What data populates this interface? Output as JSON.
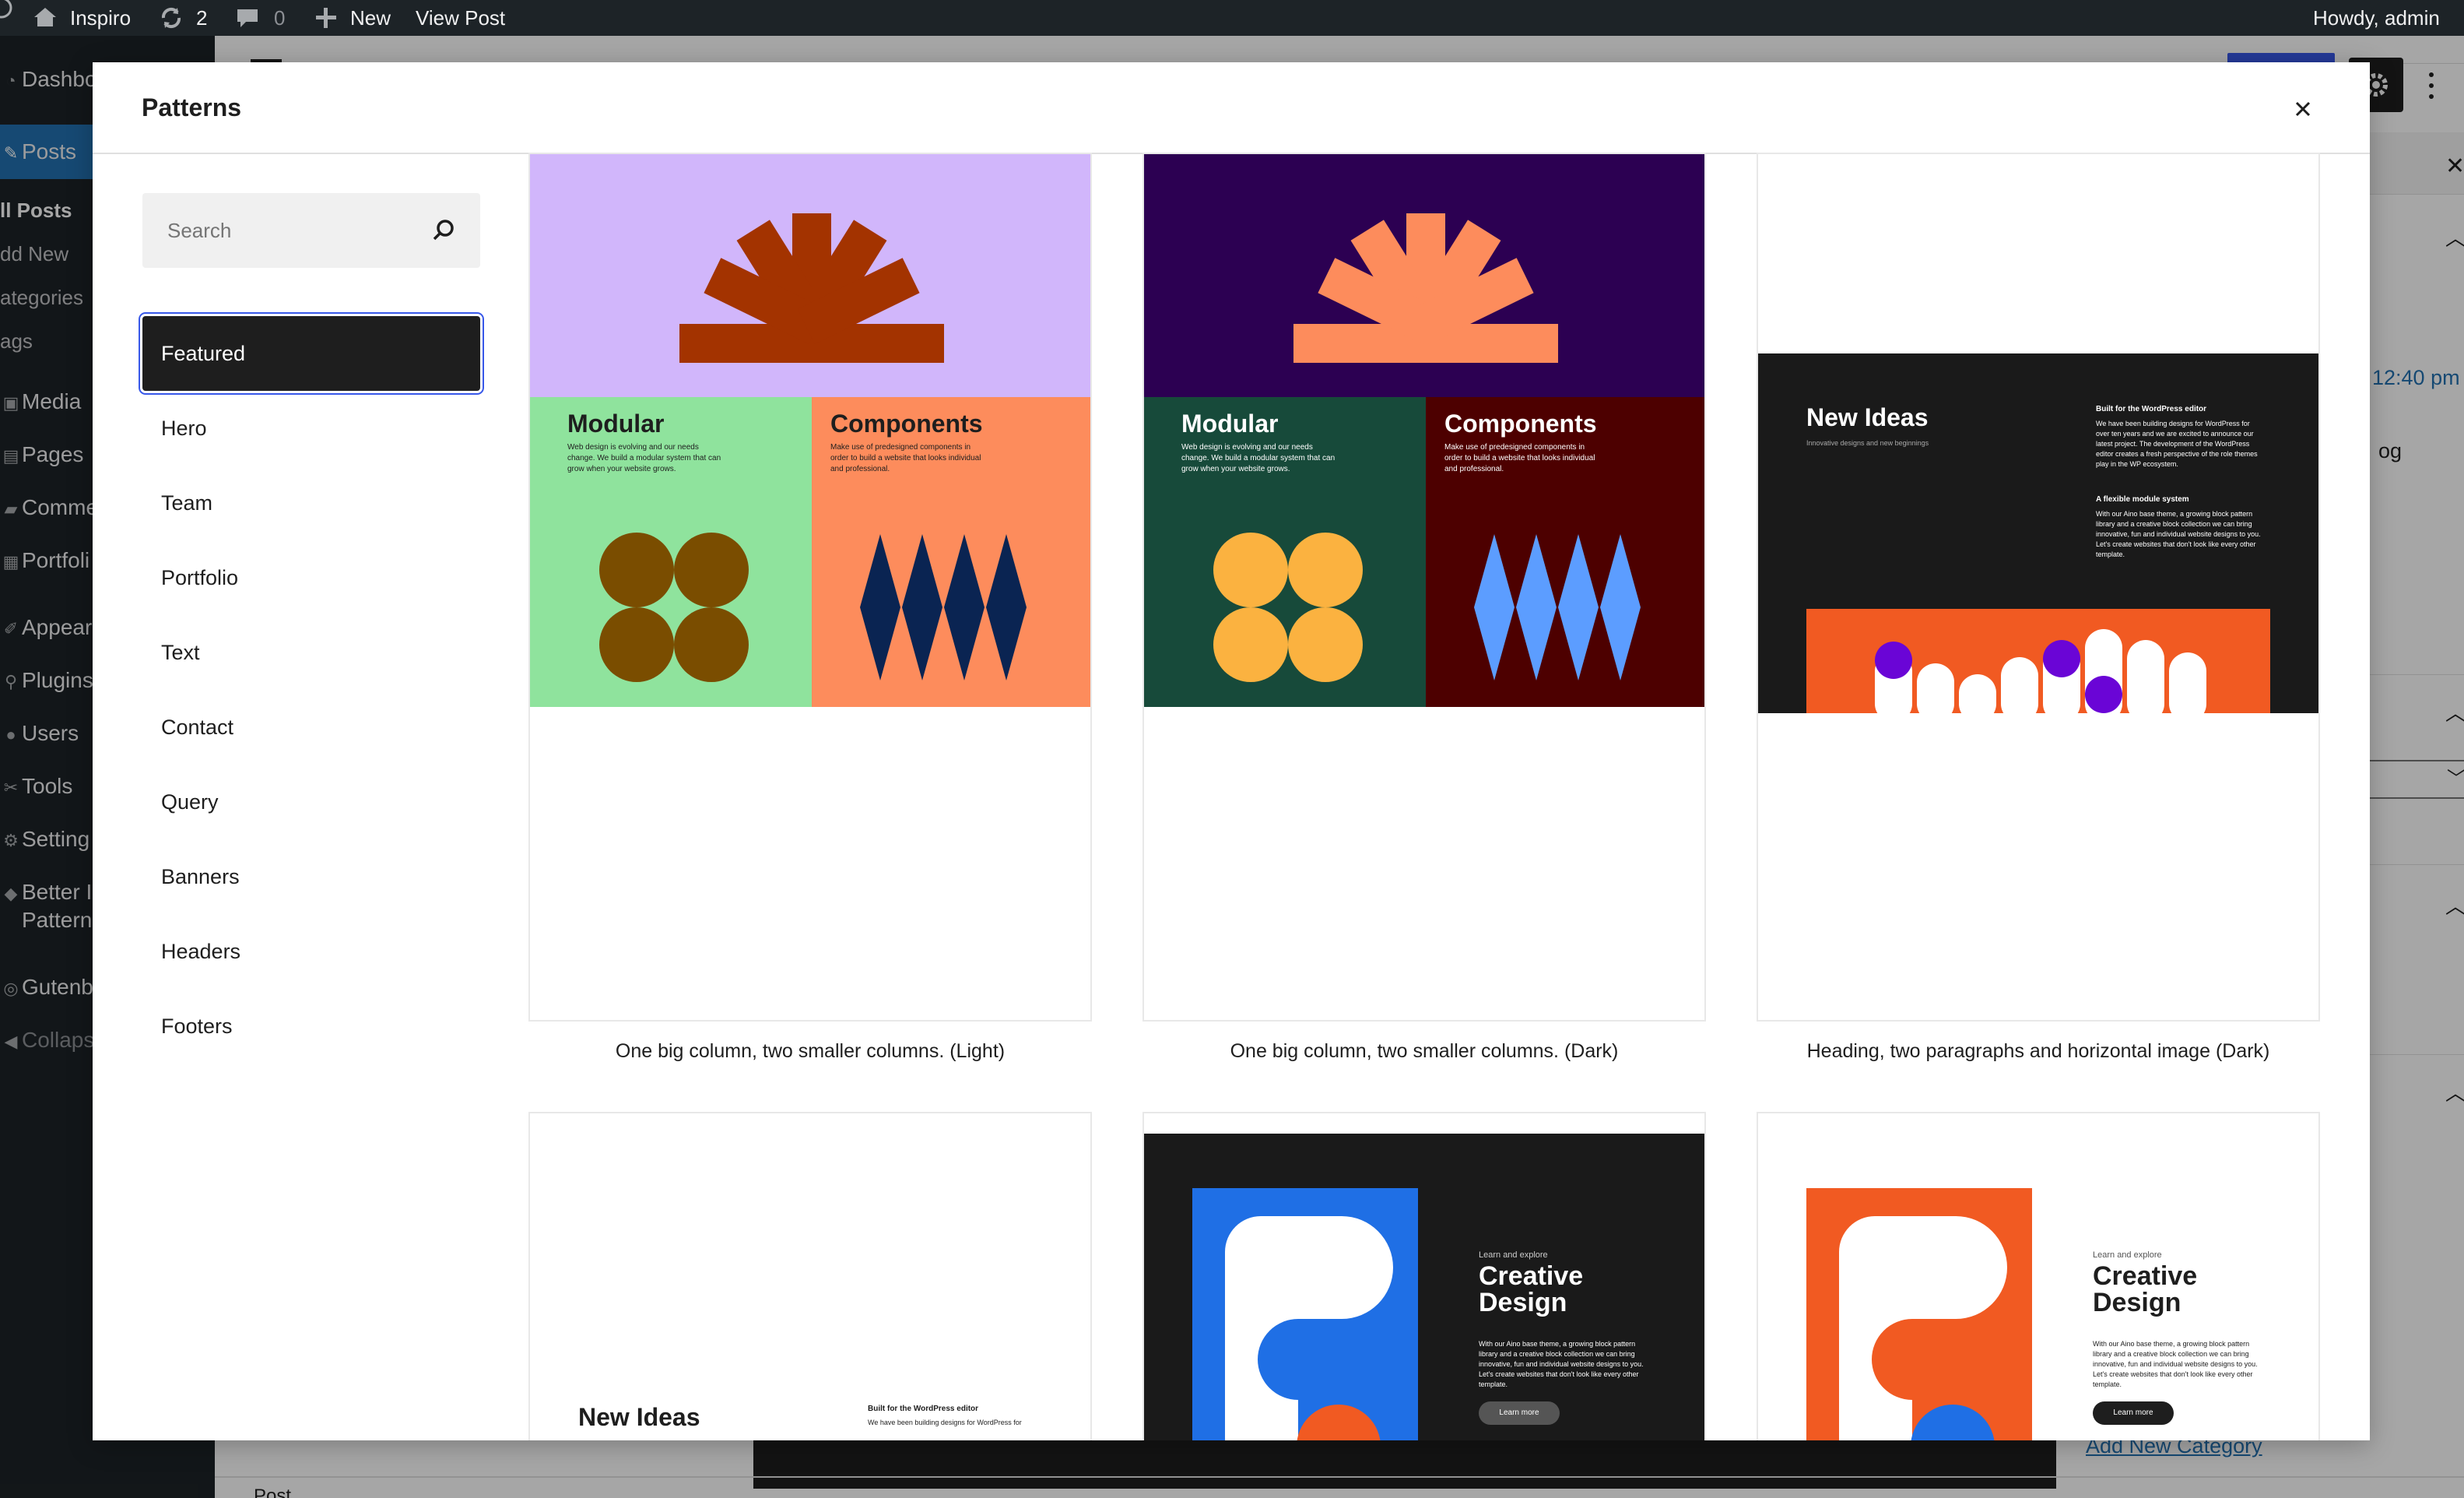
{
  "admin_bar": {
    "site_name": "Inspiro",
    "updates_count": "2",
    "comments_count": "0",
    "new_label": "New",
    "view_post_label": "View Post",
    "howdy": "Howdy, admin"
  },
  "admin_menu": {
    "dashboard": "Dashbo",
    "posts": "Posts",
    "all_posts": "ll Posts",
    "add_new": "dd New",
    "categories": "ategories",
    "tags": "ags",
    "media": "Media",
    "pages": "Pages",
    "comments": "Comme",
    "portfolio": "Portfoli",
    "appearance": "Appear",
    "plugins": "Plugins",
    "users": "Users",
    "tools": "Tools",
    "settings": "Setting",
    "better_patterns_1": "Better I",
    "better_patterns_2": "Pattern",
    "gutenberg": "Gutenb",
    "collapse": "Collaps"
  },
  "editor_background": {
    "time": "12:40 pm",
    "og_fragment": "og",
    "add_new_category": "Add New Category",
    "post_label": "Post"
  },
  "modal": {
    "title": "Patterns",
    "close_label": "×",
    "search_placeholder": "Search",
    "search_value": "",
    "categories": [
      "Featured",
      "Hero",
      "Team",
      "Portfolio",
      "Text",
      "Contact",
      "Query",
      "Banners",
      "Headers",
      "Footers"
    ],
    "active_category": "Featured"
  },
  "patterns": [
    {
      "caption": "One big column, two smaller columns. (Light)",
      "left_heading": "Modular",
      "left_text": [
        "Web design is evolving and our needs",
        "change. We build a modular system that can",
        "grow when your website grows."
      ],
      "right_heading": "Components",
      "right_text": [
        "Make use of predesigned components in",
        "order to build a website that looks individual",
        "and professional."
      ]
    },
    {
      "caption": "One big column, two smaller columns. (Dark)",
      "left_heading": "Modular",
      "left_text": [
        "Web design is evolving and our needs",
        "change. We build a modular system that can",
        "grow when your website grows."
      ],
      "right_heading": "Components",
      "right_text": [
        "Make use of predesigned components in",
        "order to build a website that looks individual",
        "and professional."
      ]
    },
    {
      "caption": "Heading, two paragraphs and horizontal image (Dark)",
      "heading": "New Ideas",
      "subheading": "Innovative designs and new beginnings",
      "p1_title": "Built for the WordPress editor",
      "p1_text": [
        "We have been building designs for WordPress for",
        "over ten years and we are excited to announce our",
        "latest project. The development of the WordPress",
        "editor creates a fresh perspective of the role themes",
        "play in the WP ecosystem."
      ],
      "p2_title": "A flexible module system",
      "p2_text": [
        "With our Aino base theme, a growing block pattern",
        "library and a creative block collection we can bring",
        "innovative, fun and individual website designs to you.",
        "Let's create websites that don't look like every other",
        "template."
      ]
    },
    {
      "heading": "New Ideas",
      "p1_title": "Built for the WordPress editor",
      "p1_text": "We have been building designs for WordPress for"
    },
    {
      "eyebrow": "Learn and explore",
      "heading_1": "Creative",
      "heading_2": "Design",
      "text": [
        "With our Aino base theme, a growing block pattern",
        "library and a creative block collection we can bring",
        "innovative, fun and individual website designs to you.",
        "Let's create websites that don't look like every other",
        "template."
      ],
      "button": "Learn more"
    },
    {
      "eyebrow": "Learn and explore",
      "heading_1": "Creative",
      "heading_2": "Design",
      "text": [
        "With our Aino base theme, a growing block pattern",
        "library and a creative block collection we can bring",
        "innovative, fun and individual website designs to you.",
        "Let's create websites that don't look like every other",
        "template."
      ],
      "button": "Learn more"
    }
  ],
  "colors": {
    "admin_dark": "#1d2327",
    "admin_blue": "#2271b1",
    "wp_blue": "#3858e9",
    "lavender": "#d1b6fb",
    "rust": "#a33300",
    "mint": "#8fe39d",
    "salmon": "#fd8c5c",
    "olive_brown": "#7a4d00",
    "navy": "#0a2452",
    "deep_purple": "#2c0052",
    "peach": "#fd8c5c",
    "forest": "#174a3a",
    "maroon": "#4d0000",
    "amber": "#fbb240",
    "sky": "#5c9dff",
    "orange": "#f15a22",
    "purple": "#6a05d6",
    "blue": "#1f6fe5"
  }
}
